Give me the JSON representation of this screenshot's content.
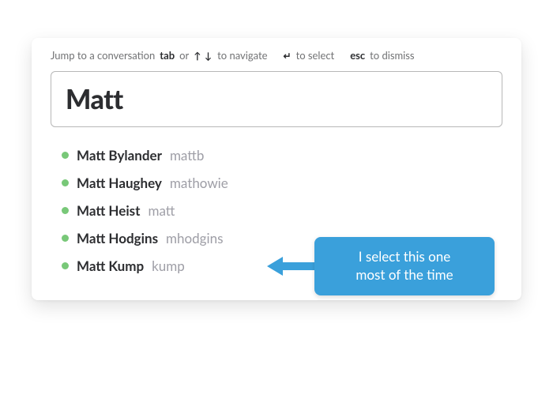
{
  "hints": {
    "intro": "Jump to a conversation",
    "tab_key": "tab",
    "or": "or",
    "arrows": "↑ ↓",
    "to_navigate": "to navigate",
    "enter": "↵",
    "to_select": "to select",
    "esc_key": "esc",
    "to_dismiss": "to dismiss"
  },
  "search": {
    "query": "Matt"
  },
  "results": [
    {
      "display_name": "Matt Bylander",
      "username": "mattb"
    },
    {
      "display_name": "Matt Haughey",
      "username": "mathowie"
    },
    {
      "display_name": "Matt Heist",
      "username": "matt"
    },
    {
      "display_name": "Matt Hodgins",
      "username": "mhodgins"
    },
    {
      "display_name": "Matt Kump",
      "username": "kump"
    }
  ],
  "callout": {
    "line1": "I select this one",
    "line2": "most of the time"
  },
  "colors": {
    "presence_active": "#78c878",
    "callout_bg": "#3aa0db"
  }
}
